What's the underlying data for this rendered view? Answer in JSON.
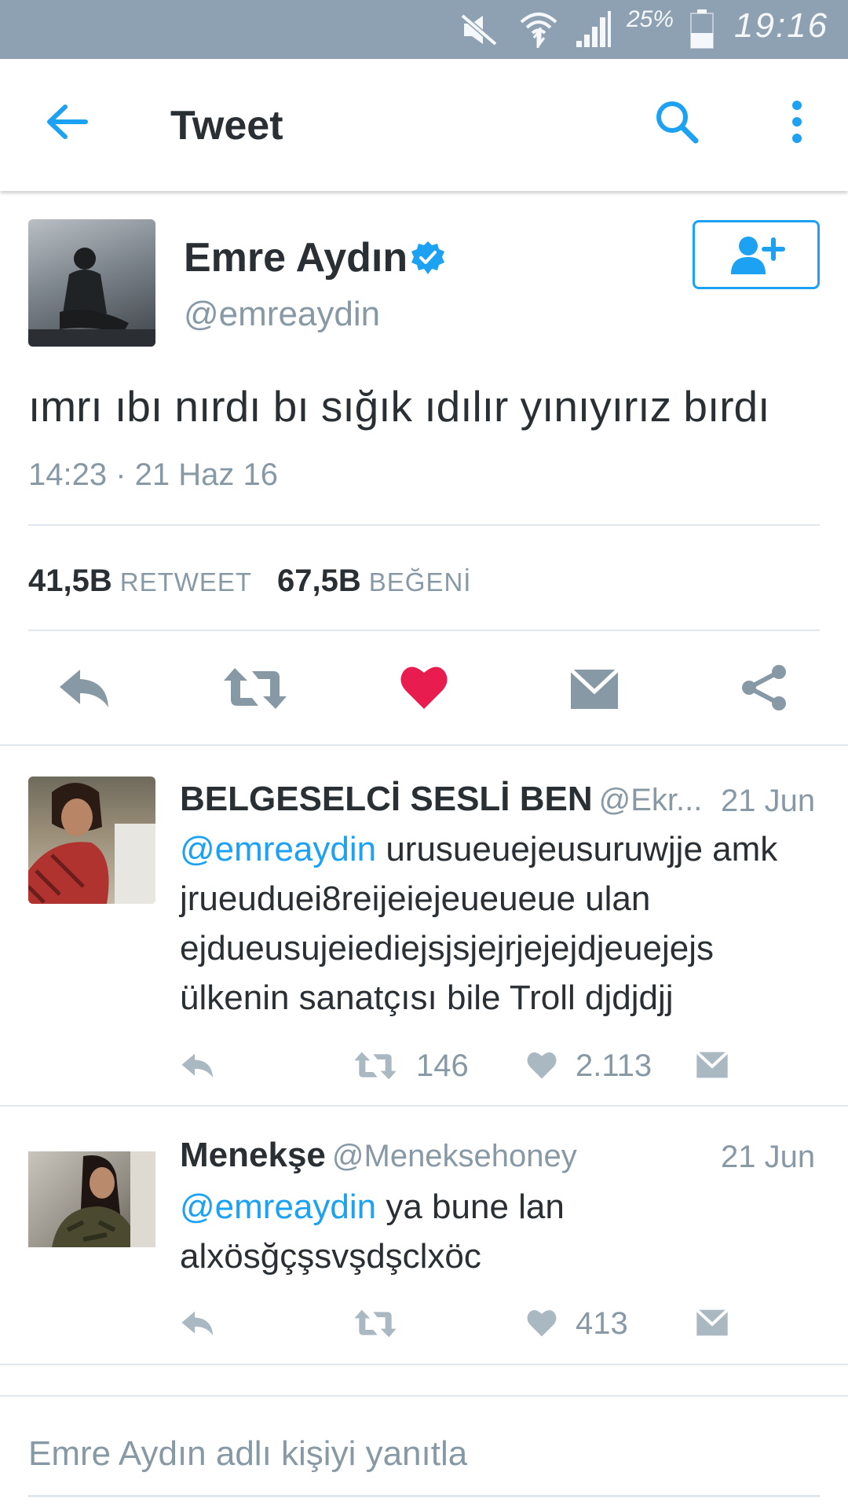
{
  "status_bar": {
    "battery": "25%",
    "time": "19:16"
  },
  "app_bar": {
    "title": "Tweet"
  },
  "tweet": {
    "author_name": "Emre Aydın",
    "author_handle": "@emreaydin",
    "text": "ımrı ıbı nırdı bı sığık ıdılır yınıyırız bırdı",
    "timestamp": "14:23 · 21 Haz 16",
    "retweets": "41,5B",
    "retweets_label": "RETWEET",
    "likes": "67,5B",
    "likes_label": "BEĞENİ",
    "colors": {
      "accent": "#1da1f2",
      "like": "#e81c4f",
      "icon_gray": "#8899a6"
    }
  },
  "replies": [
    {
      "name": "BELGESELCİ SESLİ BEN",
      "handle": "@Ekr...",
      "date": "21 Jun",
      "mention": "@emreaydin",
      "text": " urusueuejeusuruwjje amk jrueuduei8reijeiejeueueue ulan ejdueusujeiediejsjsjejrjejejdjeuejejs ülkenin sanatçısı bile Troll djdjdjj",
      "retweets": "146",
      "likes": "2.113"
    },
    {
      "name": "Menekşe",
      "handle": "@Meneksehoney",
      "date": "21 Jun",
      "mention": "@emreaydin",
      "text": " ya bune lan alxösğçşsvşdşclxöc",
      "retweets": "",
      "likes": "413"
    }
  ],
  "reply_box": {
    "placeholder": "Emre Aydın adlı kişiyi yanıtla"
  }
}
